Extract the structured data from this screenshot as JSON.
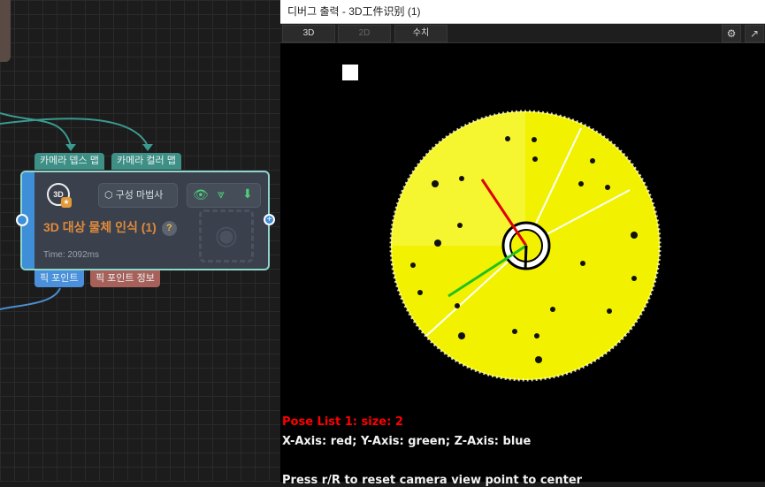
{
  "node": {
    "inputs": [
      "카메라 뎁스 맵",
      "카메라 컬러 맵"
    ],
    "outputs": [
      "픽 포인트",
      "픽 포인트 정보"
    ],
    "wizard_label": "구성 마법사",
    "title": "3D 대상 물체 인식 (1)",
    "help": "?",
    "time": "Time: 2092ms",
    "icon_label": "3D"
  },
  "panel": {
    "title": "디버그 출력 - 3D工件识别 (1)",
    "tabs": [
      {
        "label": "3D",
        "active": true
      },
      {
        "label": "2D",
        "active": false
      },
      {
        "label": "수치",
        "active": false
      }
    ],
    "pose_list": "Pose List 1: size: 2",
    "axes": "X-Axis: red; Y-Axis: green; Z-Axis: blue",
    "hint": "Press r/R to reset camera view point to center"
  },
  "colors": {
    "accent": "#3f8fd8",
    "title": "#e08a3c",
    "pose": "#ff0000"
  }
}
